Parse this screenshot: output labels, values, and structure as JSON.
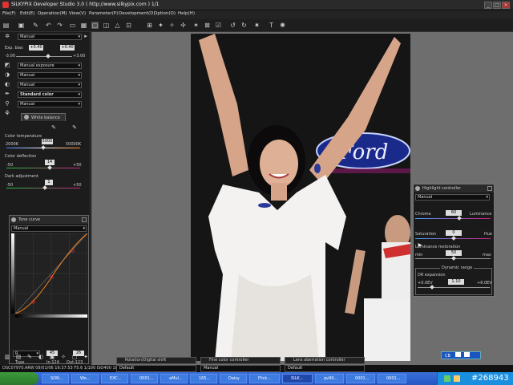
{
  "window": {
    "title": "SILKYPIX Developer Studio 3.0 ( http://www.silkypix.com )    1/1",
    "minimize": "_",
    "maximize": "□",
    "close": "×"
  },
  "menu": [
    "File(F)",
    "Edit(E)",
    "Operation(M)",
    "View(V)",
    "Parameter(P)",
    "Development(D)",
    "Option(O)",
    "Help(H)"
  ],
  "left": {
    "taste_select": "Manual",
    "exposure_bias": {
      "label": "Exp. bias",
      "value_a": "+0.40",
      "value_b": "+0.40",
      "min": "-3.00",
      "max": "+3.00"
    },
    "exposure_mode": "Manual exposure",
    "sel_3": "Manual",
    "sel_4": "Manual",
    "color_mode": "Standard color",
    "sel_6": "Manual",
    "white_balance": {
      "tab": "White balance",
      "color_temperature_label": "Color temperature",
      "color_temperature_min": "2000K",
      "color_temperature_value": "5000",
      "color_temperature_max": "50000K",
      "color_deflection_label": "Color deflection",
      "color_deflection_min": "-50",
      "color_deflection_value": "14",
      "color_deflection_max": "+50",
      "dark_adjustment_label": "Dark adjustment",
      "dark_adjustment_min": "-50",
      "dark_adjustment_value": "1",
      "dark_adjustment_max": "+50"
    },
    "tone_curve": {
      "title": "Tone curve",
      "select": "Manual",
      "channel": "R",
      "in_box": "45",
      "out_box": "26",
      "type_label": "Type",
      "in_readout": "In:124",
      "out_readout": "Out:123"
    }
  },
  "highlight_controller": {
    "title": "Highlight controller",
    "select": "Manual",
    "chroma_label": "Chroma",
    "chroma_value": "60",
    "luminance_label": "Luminance",
    "saturation_label": "Saturation",
    "saturation_value": "0",
    "hue_label": "Hue",
    "luminance_restoration_label": "Luminance restoration",
    "luminance_restoration_value": "50",
    "min_label": "min",
    "max_label": "max",
    "dynamic_range_label": "Dynamic range",
    "dr_expansion_label": "DR expansion",
    "dr_min": "+0.0EV",
    "dr_value": "1.10",
    "dr_max": "+6.0EV"
  },
  "bottom_tabs": {
    "rotation": "Rotation/Digital shift",
    "rotation_select": "Default",
    "fine_color": "Fine color controller",
    "fine_color_select": "Manual",
    "lens": "Lens aberration controller",
    "lens_select": "Default"
  },
  "zoom_chip": "CB",
  "status": {
    "text": "DSC07970.ARW 09/01/06 16:37:53 F5.6 1/100 ISO400 100mm(F)",
    "watermark": "#268943"
  },
  "taskbar": {
    "tasks": [
      "SON...",
      "Wo...",
      "EXC...",
      "0001...",
      "aMul...",
      "165...",
      "Daisy",
      "Flick...",
      "SILK...",
      "qv90...",
      "0001...",
      "0001..."
    ]
  },
  "photo": {
    "sign_text": "Ford"
  },
  "colors": {
    "accent_magenta": "#d02080",
    "accent_green": "#20c040",
    "accent_orange": "#e88020",
    "curve_orange": "#ff8a20"
  }
}
